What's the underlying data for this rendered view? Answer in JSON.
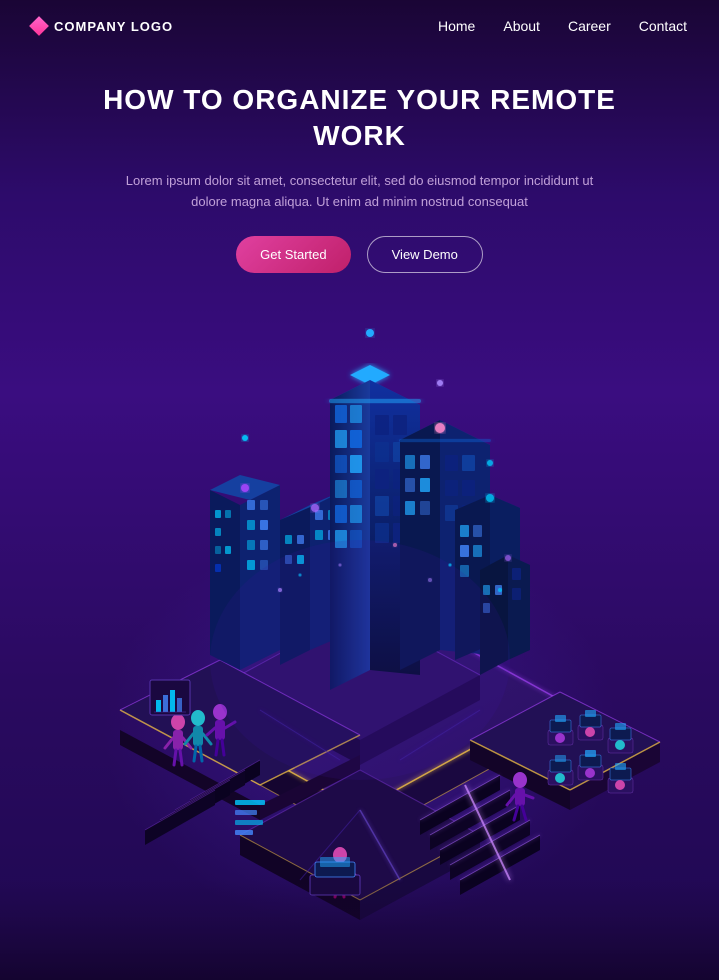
{
  "header": {
    "logo_text": "COMPANY LOGO",
    "nav": [
      {
        "label": "Home",
        "id": "home"
      },
      {
        "label": "About",
        "id": "about"
      },
      {
        "label": "Career",
        "id": "career"
      },
      {
        "label": "Contact",
        "id": "contact"
      }
    ]
  },
  "hero": {
    "title": "HOW TO ORGANIZE YOUR REMOTE WORK",
    "subtitle": "Lorem ipsum dolor sit amet, consectetur elit, sed do eiusmod tempor incididunt ut dolore magna aliqua. Ut enim ad minim nostrud consequat",
    "btn_primary": "Get Started",
    "btn_secondary": "View Demo"
  },
  "colors": {
    "bg_dark": "#1a0535",
    "bg_mid": "#2d0b6b",
    "accent_pink": "#e040a0",
    "accent_cyan": "#00e5ff",
    "accent_purple": "#aa44ff",
    "building_dark": "#1a0a40",
    "building_mid": "#2a1060",
    "neon_blue": "#4488ff",
    "neon_cyan": "#00ccff"
  }
}
